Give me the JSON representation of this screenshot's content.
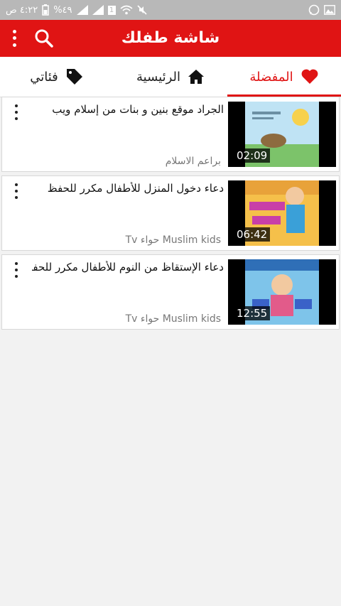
{
  "status_bar": {
    "time": "٤:٢٢ ص",
    "battery": "%٤٩",
    "sim_badge": "1"
  },
  "app_bar": {
    "title": "شاشة طفلك",
    "menu_icon": "overflow-menu-icon",
    "search_icon": "search-icon"
  },
  "tabs": [
    {
      "label": "المفضلة",
      "icon": "heart-icon",
      "active": true
    },
    {
      "label": "الرئيسية",
      "icon": "home-icon",
      "active": false
    },
    {
      "label": "فئاتي",
      "icon": "tag-icon",
      "active": false
    }
  ],
  "videos": [
    {
      "title": "الجراد موقع بنين و بنات من إسلام ويب",
      "channel": "براعم الاسلام",
      "duration": "02:09"
    },
    {
      "title": "دعاء دخول المنزل للأطفال مكرر للحفظ",
      "channel": "Muslim kids حواء Tv",
      "duration": "06:42"
    },
    {
      "title": "دعاء الإستقاظ من النوم للأطفال مكرر للحفظ",
      "channel": "Muslim kids حواء Tv",
      "duration": "12:55"
    }
  ],
  "colors": {
    "accent": "#e01414",
    "status_bar": "#b8b8b8"
  }
}
